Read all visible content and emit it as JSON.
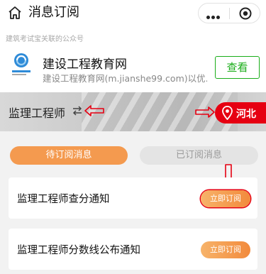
{
  "header": {
    "title": "消息订阅"
  },
  "official_account": {
    "hint": "建筑考试宝关联的公众号",
    "name": "建设工程教育网",
    "description": "建设工程教育网(m.jianshe99.com)以优...",
    "view_label": "查看"
  },
  "banner": {
    "exam_title": "监理工程师",
    "region": "河北"
  },
  "tabs": [
    {
      "label": "待订阅消息",
      "active": true
    },
    {
      "label": "已订阅消息",
      "active": false
    }
  ],
  "items": [
    {
      "title": "监理工程师查分通知",
      "button_label": "立即订阅"
    },
    {
      "title": "监理工程师分数线公布通知",
      "button_label": "立即订阅"
    }
  ],
  "colors": {
    "accent_orange": "#f28a3c",
    "region_red": "#e60012",
    "view_green": "#1aad19"
  }
}
